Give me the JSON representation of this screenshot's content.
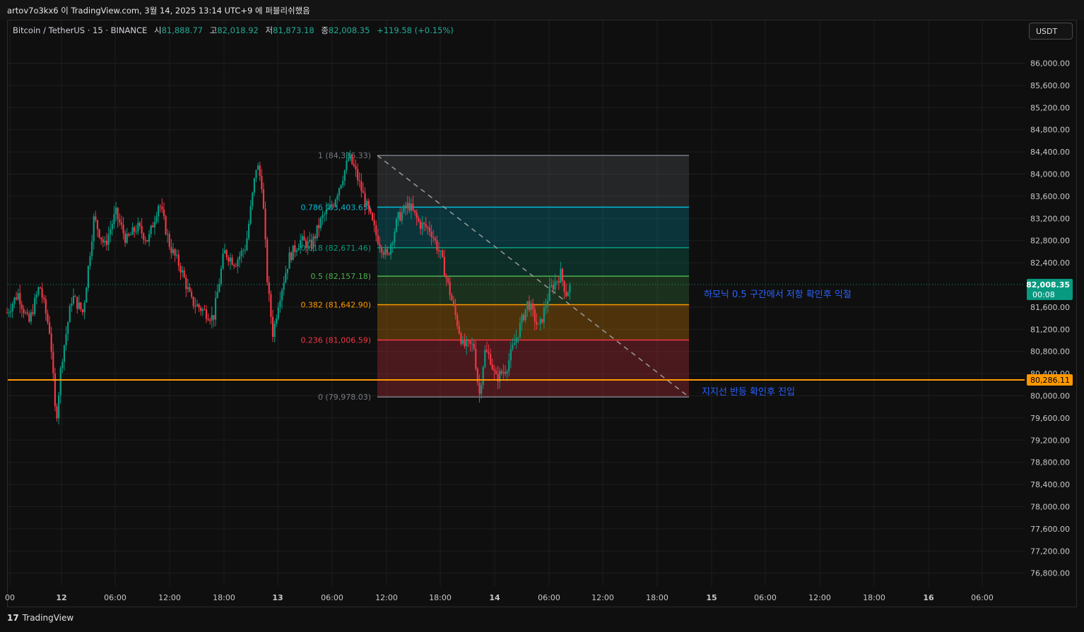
{
  "header": {
    "title": "artov7o3kx6 이 TradingView.com, 3월 14, 2025 13:14 UTC+9 에 퍼블리쉬했음"
  },
  "legend": {
    "symbol": "Bitcoin / TetherUS · 15 · BINANCE",
    "open_label": "시",
    "open": "81,888.77",
    "high_label": "고",
    "high": "82,018.92",
    "low_label": "저",
    "low": "81,873.18",
    "close_label": "종",
    "close": "82,008.35",
    "change": "+119.58 (+0.15%)"
  },
  "currency_button": "USDT",
  "footer": {
    "brand": "TradingView",
    "logo_text": "17"
  },
  "chart_data": {
    "type": "candlestick",
    "interval": "15",
    "ylim": [
      76600,
      86400
    ],
    "y_ticks": [
      "86,000.00",
      "85,600.00",
      "85,200.00",
      "84,800.00",
      "84,400.00",
      "84,000.00",
      "83,600.00",
      "83,200.00",
      "82,800.00",
      "82,400.00",
      "81,600.00",
      "81,200.00",
      "80,800.00",
      "80,400.00",
      "80,000.00",
      "79,600.00",
      "79,200.00",
      "78,800.00",
      "78,400.00",
      "78,000.00",
      "77,600.00",
      "77,200.00",
      "76,800.00"
    ],
    "x_ticks": [
      "00",
      "12",
      "06:00",
      "12:00",
      "18:00",
      "13",
      "06:00",
      "12:00",
      "18:00",
      "14",
      "06:00",
      "12:00",
      "18:00",
      "15",
      "06:00",
      "12:00",
      "18:00",
      "16",
      "06:00"
    ],
    "price_path": [
      [
        0,
        81500
      ],
      [
        2,
        81850
      ],
      [
        4,
        81300
      ],
      [
        6,
        82000
      ],
      [
        8,
        81100
      ],
      [
        9,
        79500
      ],
      [
        10,
        80600
      ],
      [
        12,
        81800
      ],
      [
        14,
        81500
      ],
      [
        16,
        83200
      ],
      [
        18,
        82700
      ],
      [
        20,
        83300
      ],
      [
        22,
        82800
      ],
      [
        24,
        83050
      ],
      [
        26,
        82800
      ],
      [
        28,
        83500
      ],
      [
        30,
        82700
      ],
      [
        32,
        82300
      ],
      [
        34,
        81700
      ],
      [
        36,
        81550
      ],
      [
        38,
        81400
      ],
      [
        40,
        82600
      ],
      [
        42,
        82400
      ],
      [
        44,
        82700
      ],
      [
        46,
        84200
      ],
      [
        47,
        83800
      ],
      [
        48,
        82000
      ],
      [
        49,
        81100
      ],
      [
        50,
        81700
      ],
      [
        52,
        82500
      ],
      [
        54,
        82800
      ],
      [
        56,
        82700
      ],
      [
        58,
        83200
      ],
      [
        60,
        83450
      ],
      [
        62,
        84000
      ],
      [
        63,
        84300
      ],
      [
        64,
        84100
      ],
      [
        66,
        83500
      ],
      [
        68,
        82900
      ],
      [
        70,
        82500
      ],
      [
        72,
        83200
      ],
      [
        74,
        83450
      ],
      [
        76,
        83100
      ],
      [
        78,
        83000
      ],
      [
        80,
        82500
      ],
      [
        82,
        81700
      ],
      [
        84,
        80900
      ],
      [
        86,
        80900
      ],
      [
        87,
        80000
      ],
      [
        88,
        80800
      ],
      [
        89,
        80700
      ],
      [
        90,
        80300
      ],
      [
        92,
        80500
      ],
      [
        94,
        81100
      ],
      [
        96,
        81700
      ],
      [
        98,
        81200
      ],
      [
        100,
        81900
      ],
      [
        102,
        82200
      ],
      [
        103,
        81850
      ],
      [
        104,
        82010
      ]
    ],
    "current_price": {
      "value": 82008.35,
      "label": "82,008.35",
      "countdown": "00:08",
      "color": "#089981"
    },
    "horizontal_line": {
      "value": 80286.11,
      "label": "80,286.11",
      "color": "#ff9800"
    },
    "fibonacci": {
      "high": 84336.33,
      "low": 79978.03,
      "levels": [
        {
          "ratio": "1",
          "price": "84,336.33",
          "value": 84336.33,
          "color": "#787b86"
        },
        {
          "ratio": "0.786",
          "price": "83,403.65",
          "value": 83403.65,
          "color": "#00bcd4"
        },
        {
          "ratio": "0.618",
          "price": "82,671.46",
          "value": 82671.46,
          "color": "#089981"
        },
        {
          "ratio": "0.5",
          "price": "82,157.18",
          "value": 82157.18,
          "color": "#4caf50"
        },
        {
          "ratio": "0.382",
          "price": "81,642.90",
          "value": 81642.9,
          "color": "#ff9800"
        },
        {
          "ratio": "0.236",
          "price": "81,006.59",
          "value": 81006.59,
          "color": "#f23645"
        },
        {
          "ratio": "0",
          "price": "79,978.03",
          "value": 79978.03,
          "color": "#787b86"
        }
      ]
    },
    "annotations": [
      {
        "text": "하모닉 0.5 구간에서 저항 확인후 익절",
        "color": "#2962ff"
      },
      {
        "text": "지지선 반등 확인후 진입",
        "color": "#2962ff"
      }
    ],
    "colors": {
      "up": "#089981",
      "down": "#f23645",
      "grid": "#1e1e1e"
    }
  }
}
